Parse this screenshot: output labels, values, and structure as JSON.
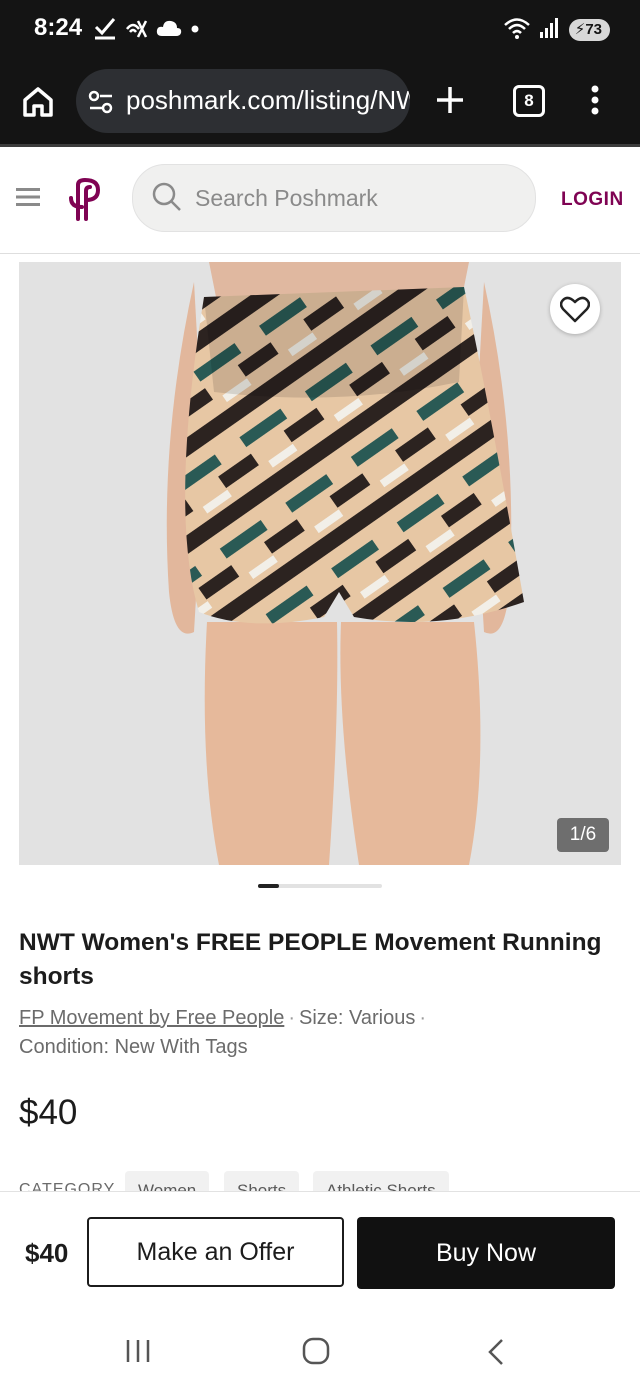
{
  "status_bar": {
    "time": "8:24",
    "battery": "73",
    "icons_left": [
      "check-icon",
      "no-signal-icon",
      "cloud-icon",
      "dot-icon"
    ],
    "icons_right": [
      "wifi-6e-icon",
      "signal-icon",
      "battery-icon"
    ]
  },
  "browser": {
    "url": "poshmark.com/listing/NWT-Women",
    "tab_count": "8"
  },
  "header": {
    "search_placeholder": "Search Poshmark",
    "login_label": "LOGIN",
    "brand_color": "#7f0353"
  },
  "gallery": {
    "counter": "1/6",
    "current_index": 1,
    "total": 6
  },
  "listing": {
    "title": "NWT Women's FREE PEOPLE Movement Running shorts",
    "brand": "FP Movement by Free People",
    "size": "Size: Various",
    "condition": "Condition: New With Tags",
    "price": "$40",
    "category_label": "CATEGORY",
    "category_chips": [
      "Women",
      "Shorts",
      "Athletic Shorts"
    ]
  },
  "action_bar": {
    "price": "$40",
    "offer_label": "Make an Offer",
    "buy_label": "Buy Now"
  }
}
